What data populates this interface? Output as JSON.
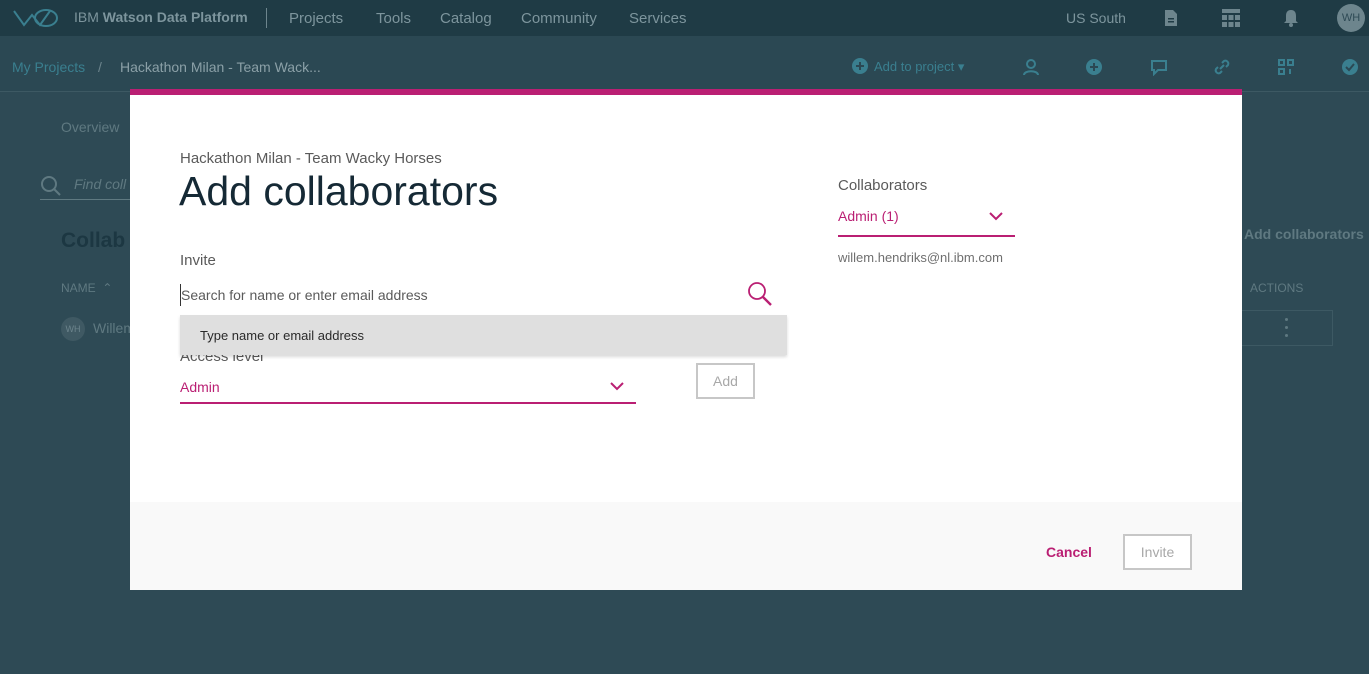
{
  "colors": {
    "accent": "#ba1f73",
    "modal_bg": "#ffffff",
    "backdrop": "#2e4a55"
  },
  "topbar": {
    "brand_prefix": "IBM ",
    "brand_bold": "Watson Data Platform",
    "nav": [
      "Projects",
      "Tools",
      "Catalog",
      "Community",
      "Services"
    ],
    "region": "US South",
    "avatar_initials": "WH",
    "icons": [
      "document-icon",
      "grid-icon",
      "bell-icon"
    ]
  },
  "subbar": {
    "crumb_root": "My Projects",
    "crumb_sep": "/",
    "crumb_current": "Hackathon Milan - Team Wack...",
    "add_to_project": "Add to project"
  },
  "background_page": {
    "tab_overview": "Overview",
    "search_placeholder": "Find coll",
    "section_title": "Collab",
    "col_name": "NAME",
    "row_avatar": "WH",
    "row_name": "Willem",
    "add_collaborators": "Add collaborators",
    "col_actions": "ACTIONS"
  },
  "modal": {
    "project_name": "Hackathon Milan - Team Wacky Horses",
    "title": "Add collaborators",
    "invite_label": "Invite",
    "search_placeholder": "Search for name or enter email address",
    "suggestion": "Type name or email address",
    "access_label": "Access level",
    "access_value": "Admin",
    "add_label": "Add",
    "collaborators_label": "Collaborators",
    "collaborators_filter": "Admin (1)",
    "collaborator_email": "willem.hendriks@nl.ibm.com",
    "cancel_label": "Cancel",
    "invite_button_label": "Invite"
  }
}
